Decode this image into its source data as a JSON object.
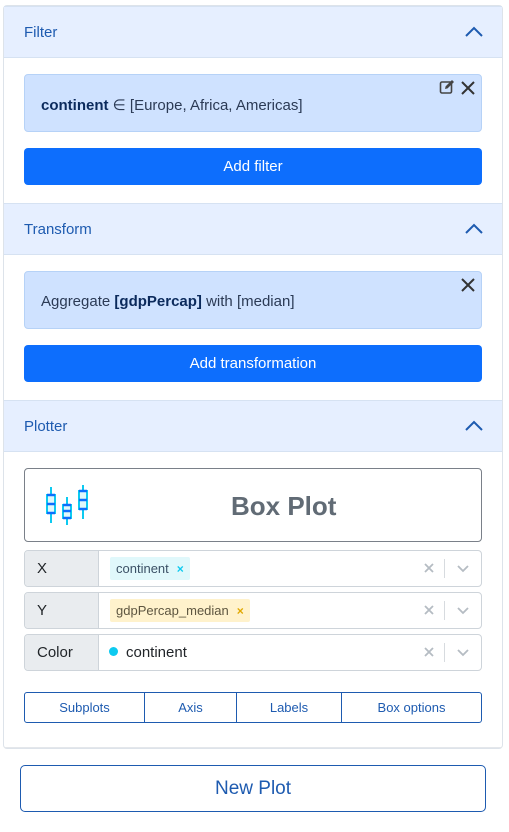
{
  "filter": {
    "title": "Filter",
    "card": {
      "field": "continent",
      "operator": "∈",
      "values": "[Europe, Africa, Americas]"
    },
    "add_label": "Add filter"
  },
  "transform": {
    "title": "Transform",
    "card": {
      "prefix": "Aggregate",
      "column": "[gdpPercap]",
      "middle": "with",
      "agg": "[median]"
    },
    "add_label": "Add transformation"
  },
  "plotter": {
    "title": "Plotter",
    "plot_type": {
      "label": "Box Plot",
      "icon": "box-plot-icon"
    },
    "fields": {
      "x": {
        "label": "X",
        "value": "continent",
        "tag_remove": "×"
      },
      "y": {
        "label": "Y",
        "value": "gdpPercap_median",
        "tag_remove": "×"
      },
      "color": {
        "label": "Color",
        "value": "continent"
      }
    },
    "tabs": [
      "Subplots",
      "Axis",
      "Labels",
      "Box options"
    ]
  },
  "new_plot_label": "New Plot",
  "colors": {
    "primary": "#0d6efd",
    "header_bg": "#e6efff",
    "card_bg": "#cfe2ff",
    "accent_text": "#1e5bb0",
    "cyan": "#0dcaf0",
    "yellow_tag": "#fff2cc"
  }
}
